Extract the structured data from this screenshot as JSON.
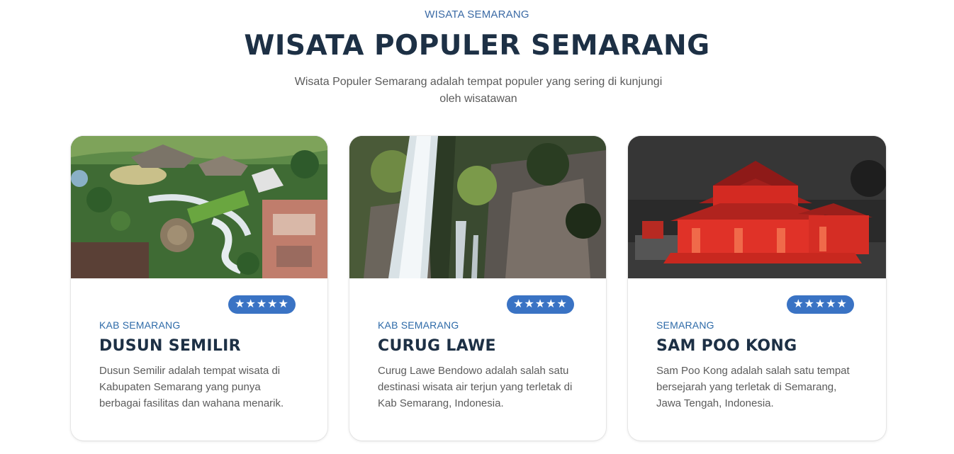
{
  "section": {
    "eyebrow": "WISATA SEMARANG",
    "title": "WISATA POPULER SEMARANG",
    "subtitle": "Wisata Populer Semarang adalah tempat populer yang sering di kunjungi oleh wisatawan"
  },
  "colors": {
    "accent": "#3a73c4",
    "title": "#1d3045",
    "region": "#2d6aa8"
  },
  "cards": [
    {
      "rating": "★★★★★",
      "region": "KAB SEMARANG",
      "name": "DUSUN SEMILIR",
      "description": "Dusun Semilir adalah tempat wisata di Kabupaten Semarang yang punya berbagai fasilitas dan wahana menarik."
    },
    {
      "rating": "★★★★★",
      "region": "KAB SEMARANG",
      "name": "CURUG LAWE",
      "description": "Curug Lawe Bendowo adalah salah satu destinasi wisata air terjun yang terletak di Kab Semarang, Indonesia."
    },
    {
      "rating": "★★★★★",
      "region": "SEMARANG",
      "name": "SAM POO KONG",
      "description": "Sam Poo Kong adalah salah satu tempat bersejarah yang terletak di Semarang, Jawa Tengah, Indonesia."
    }
  ]
}
